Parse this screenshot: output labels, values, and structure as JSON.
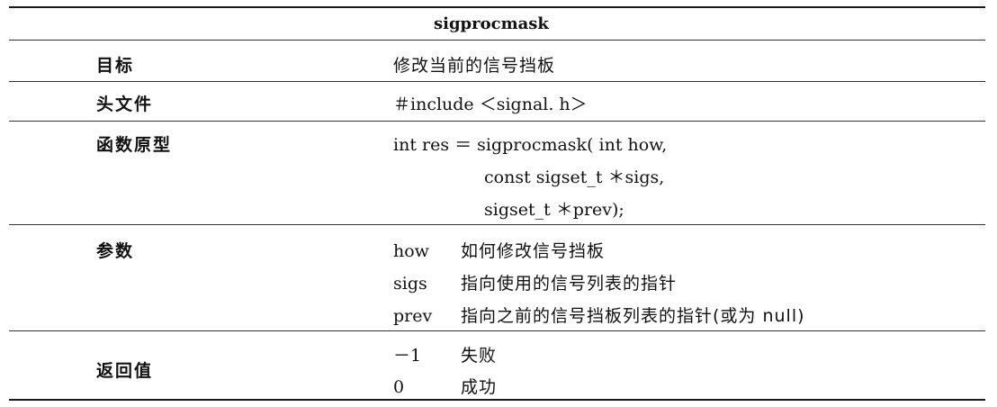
{
  "table": {
    "title": "sigprocmask",
    "rows": [
      {
        "label": "目标",
        "value": "修改当前的信号挡板"
      },
      {
        "label": "头文件",
        "value": "＃include ＜signal. h＞"
      },
      {
        "label": "函数原型",
        "lines": [
          "int res ＝ sigprocmask( int how,",
          "const sigset_t ＊sigs,",
          "sigset_t ＊prev);"
        ]
      },
      {
        "label": "参数",
        "params": [
          {
            "name": "how",
            "desc": "如何修改信号挡板"
          },
          {
            "name": "sigs",
            "desc": "指向使用的信号列表的指针"
          },
          {
            "name": "prev",
            "desc": "指向之前的信号挡板列表的指针(或为 null)"
          }
        ]
      },
      {
        "label": "返回值",
        "returns": [
          {
            "code": "－1",
            "desc": "失败"
          },
          {
            "code": "0",
            "desc": "成功"
          }
        ]
      }
    ]
  }
}
